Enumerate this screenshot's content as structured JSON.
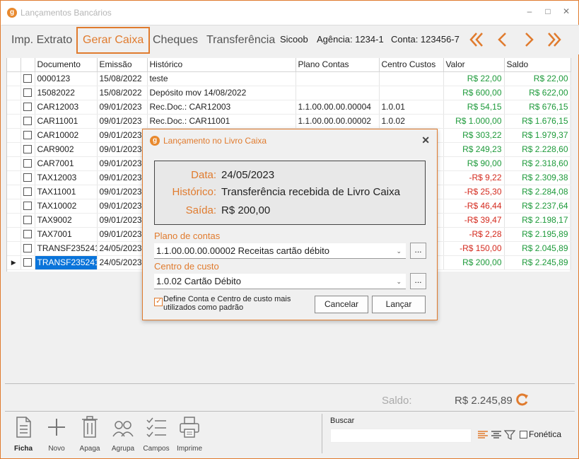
{
  "window": {
    "title": "Lançamentos Bancários",
    "logo_letter": "g",
    "controls": [
      "–",
      "□",
      "✕"
    ]
  },
  "toolbar": {
    "tabs": [
      "Imp. Extrato",
      "Gerar Caixa",
      "Cheques",
      "Transferência"
    ],
    "active_tab": "Gerar Caixa",
    "bank": "Sicoob",
    "agency": "Agência: 1234-1",
    "account": "Conta: 123456-7",
    "accent_color": "#e07b2e"
  },
  "grid": {
    "columns": [
      "",
      "",
      "Documento",
      "Emissão",
      "Histórico",
      "Plano Contas",
      "Centro Custos",
      "Valor",
      "Saldo"
    ],
    "rows": [
      {
        "documento": "0000123",
        "emissao": "15/08/2022",
        "historico": "teste",
        "plano": "",
        "centro": "",
        "valor": "R$ 22,00",
        "saldo": "R$ 22,00",
        "valor_sign": "pos"
      },
      {
        "documento": "15082022",
        "emissao": "15/08/2022",
        "historico": "Depósito mov 14/08/2022",
        "plano": "",
        "centro": "",
        "valor": "R$ 600,00",
        "saldo": "R$ 622,00",
        "valor_sign": "pos"
      },
      {
        "documento": "CAR12003",
        "emissao": "09/01/2023",
        "historico": "Rec.Doc.: CAR12003",
        "plano": "1.1.00.00.00.00004",
        "centro": "1.0.01",
        "valor": "R$ 54,15",
        "saldo": "R$ 676,15",
        "valor_sign": "pos"
      },
      {
        "documento": "CAR11001",
        "emissao": "09/01/2023",
        "historico": "Rec.Doc.: CAR11001",
        "plano": "1.1.00.00.00.00002",
        "centro": "1.0.02",
        "valor": "R$ 1.000,00",
        "saldo": "R$ 1.676,15",
        "valor_sign": "pos"
      },
      {
        "documento": "CAR10002",
        "emissao": "09/01/2023",
        "historico": "",
        "plano": "",
        "centro": "",
        "valor": "R$ 303,22",
        "saldo": "R$ 1.979,37",
        "valor_sign": "pos"
      },
      {
        "documento": "CAR9002",
        "emissao": "09/01/2023",
        "historico": "",
        "plano": "",
        "centro": "",
        "valor": "R$ 249,23",
        "saldo": "R$ 2.228,60",
        "valor_sign": "pos"
      },
      {
        "documento": "CAR7001",
        "emissao": "09/01/2023",
        "historico": "",
        "plano": "",
        "centro": "",
        "valor": "R$ 90,00",
        "saldo": "R$ 2.318,60",
        "valor_sign": "pos"
      },
      {
        "documento": "TAX12003",
        "emissao": "09/01/2023",
        "historico": "",
        "plano": "",
        "centro": "",
        "valor": "-R$ 9,22",
        "saldo": "R$ 2.309,38",
        "valor_sign": "neg"
      },
      {
        "documento": "TAX11001",
        "emissao": "09/01/2023",
        "historico": "",
        "plano": "",
        "centro": "",
        "valor": "-R$ 25,30",
        "saldo": "R$ 2.284,08",
        "valor_sign": "neg"
      },
      {
        "documento": "TAX10002",
        "emissao": "09/01/2023",
        "historico": "",
        "plano": "",
        "centro": "",
        "valor": "-R$ 46,44",
        "saldo": "R$ 2.237,64",
        "valor_sign": "neg"
      },
      {
        "documento": "TAX9002",
        "emissao": "09/01/2023",
        "historico": "",
        "plano": "",
        "centro": "",
        "valor": "-R$ 39,47",
        "saldo": "R$ 2.198,17",
        "valor_sign": "neg"
      },
      {
        "documento": "TAX7001",
        "emissao": "09/01/2023",
        "historico": "",
        "plano": "",
        "centro": "",
        "valor": "-R$ 2,28",
        "saldo": "R$ 2.195,89",
        "valor_sign": "neg"
      },
      {
        "documento": "TRANSF235241",
        "emissao": "24/05/2023",
        "historico": "",
        "plano": "",
        "centro": "",
        "valor": "-R$ 150,00",
        "saldo": "R$ 2.045,89",
        "valor_sign": "neg"
      },
      {
        "documento": "TRANSF235241",
        "emissao": "24/05/2023",
        "historico": "",
        "plano": "",
        "centro": "",
        "valor": "R$ 200,00",
        "saldo": "R$ 2.245,89",
        "valor_sign": "pos",
        "current": true
      }
    ],
    "positive_color": "#1d9a3a",
    "negative_color": "#d42a1e"
  },
  "dialog": {
    "title": "Lançamento no Livro Caixa",
    "close": "✕",
    "data_label": "Data:",
    "data_value": "24/05/2023",
    "historico_label": "Histórico:",
    "historico_value": "Transferência recebida de Livro Caixa",
    "saida_label": "Saída:",
    "saida_value": "R$ 200,00",
    "plano_label": "Plano de contas",
    "plano_value": "1.1.00.00.00.00002  Receitas cartão débito",
    "centro_label": "Centro de custo",
    "centro_value": "1.0.02  Cartão Débito",
    "ellipsis": "...",
    "default_text": "Define Conta e Centro de custo mais utilizados como padrão",
    "default_checked": true,
    "cancel_label": "Cancelar",
    "launch_label": "Lançar"
  },
  "footer": {
    "saldo_label": "Saldo:",
    "saldo_value": "R$ 2.245,89",
    "tools": [
      "Ficha",
      "Novo",
      "Apaga",
      "Agrupa",
      "Campos",
      "Imprime"
    ],
    "search_label": "Buscar",
    "search_value": "",
    "fonetica_label": "Fonética",
    "fonetica_checked": false
  }
}
